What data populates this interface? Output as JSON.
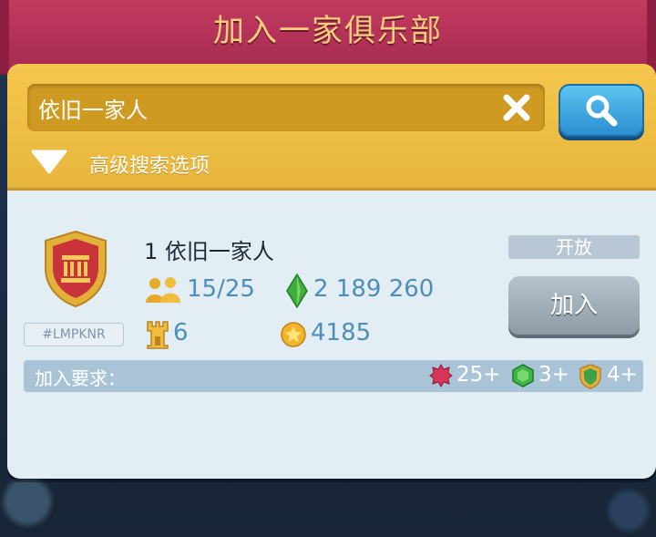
{
  "header": {
    "title": "加入一家俱乐部"
  },
  "search": {
    "value": "依旧一家人",
    "clear_icon": "close-icon",
    "button_icon": "search-icon",
    "advanced_label": "高级搜索选项"
  },
  "club": {
    "name": "1 依旧一家人",
    "tag": "#LMPKNR",
    "members": "15/25",
    "gems": "2 189 260",
    "level": "6",
    "stars": "4185",
    "status": "开放",
    "join_label": "加入",
    "badge_icon": "club-shield-icon"
  },
  "requirements": {
    "label": "加入要求：",
    "items": [
      {
        "icon": "red-star-icon",
        "value": "25+"
      },
      {
        "icon": "green-gem-icon",
        "value": "3+"
      },
      {
        "icon": "shield-icon",
        "value": "4+"
      }
    ]
  },
  "colors": {
    "title_bar": "#b53257",
    "title_text": "#f6cf7a",
    "search_panel": "#f0c046",
    "search_button": "#2b8fd0",
    "stat_text": "#4d8fb9",
    "join_button": "#9aa8b2"
  }
}
